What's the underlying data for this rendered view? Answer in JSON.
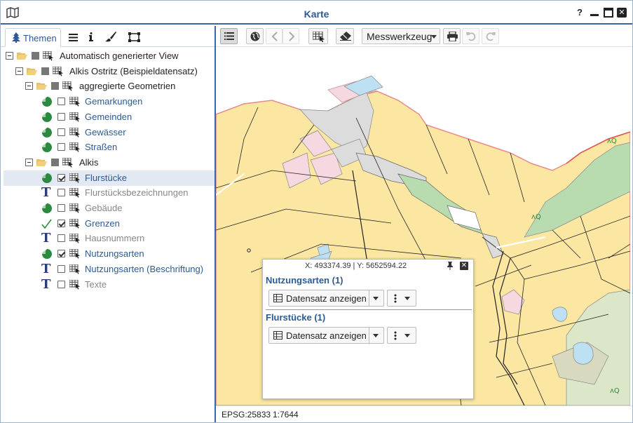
{
  "window": {
    "title": "Karte",
    "help_label": "?"
  },
  "left_panel": {
    "tabs": [
      {
        "label": "Themen",
        "icon": "tree-icon"
      },
      {
        "label": "",
        "icon": "list-icon"
      },
      {
        "label": "",
        "icon": "info-icon"
      },
      {
        "label": "",
        "icon": "brush-icon"
      },
      {
        "label": "",
        "icon": "select-area-icon"
      }
    ],
    "tree": [
      {
        "label": "Automatisch generierter View",
        "level": 0,
        "kind": "folder",
        "state": "dark"
      },
      {
        "label": "Alkis Ostritz (Beispieldatensatz)",
        "level": 1,
        "kind": "folder",
        "state": "dark"
      },
      {
        "label": "aggregierte Geometrien",
        "level": 2,
        "kind": "folder",
        "state": "dark"
      },
      {
        "label": "Gemarkungen",
        "level": 3,
        "kind": "polygon",
        "checked": false,
        "state": "blue"
      },
      {
        "label": "Gemeinden",
        "level": 3,
        "kind": "polygon",
        "checked": false,
        "state": "blue"
      },
      {
        "label": "Gewässer",
        "level": 3,
        "kind": "polygon",
        "checked": false,
        "state": "blue"
      },
      {
        "label": "Straßen",
        "level": 3,
        "kind": "polygon",
        "checked": false,
        "state": "blue"
      },
      {
        "label": "Alkis",
        "level": 2,
        "kind": "folder",
        "state": "dark"
      },
      {
        "label": "Flurstücke",
        "level": 3,
        "kind": "polygon",
        "checked": true,
        "state": "blue",
        "selected": true
      },
      {
        "label": "Flurstücksbezeichnungen",
        "level": 3,
        "kind": "text",
        "checked": false,
        "state": "gray"
      },
      {
        "label": "Gebäude",
        "level": 3,
        "kind": "polygon",
        "checked": false,
        "state": "gray"
      },
      {
        "label": "Grenzen",
        "level": 3,
        "kind": "line",
        "checked": true,
        "state": "blue"
      },
      {
        "label": "Hausnummern",
        "level": 3,
        "kind": "text",
        "checked": false,
        "state": "gray"
      },
      {
        "label": "Nutzungsarten",
        "level": 3,
        "kind": "polygon",
        "checked": true,
        "state": "blue"
      },
      {
        "label": "Nutzungsarten (Beschriftung)",
        "level": 3,
        "kind": "text",
        "checked": false,
        "state": "blue"
      },
      {
        "label": "Texte",
        "level": 3,
        "kind": "text",
        "checked": false,
        "state": "gray"
      }
    ]
  },
  "toolbar": {
    "measure_label": "Messwerkzeug"
  },
  "popup": {
    "coords": "X: 493374.39 | Y: 5652594.22",
    "sections": [
      {
        "title": "Nutzungsarten (1)",
        "button_label": "Datensatz anzeigen"
      },
      {
        "title": "Flurstücke (1)",
        "button_label": "Datensatz anzeigen"
      }
    ]
  },
  "status": {
    "epsg": "EPSG:25833",
    "scale": "1:7644"
  },
  "colors": {
    "accent": "#3a67a8",
    "title": "#2d5a93",
    "map_yellow": "#fbe6a2",
    "map_green": "#b8dcb0",
    "map_blue": "#bde0f3",
    "map_pink": "#f6d8e0"
  }
}
